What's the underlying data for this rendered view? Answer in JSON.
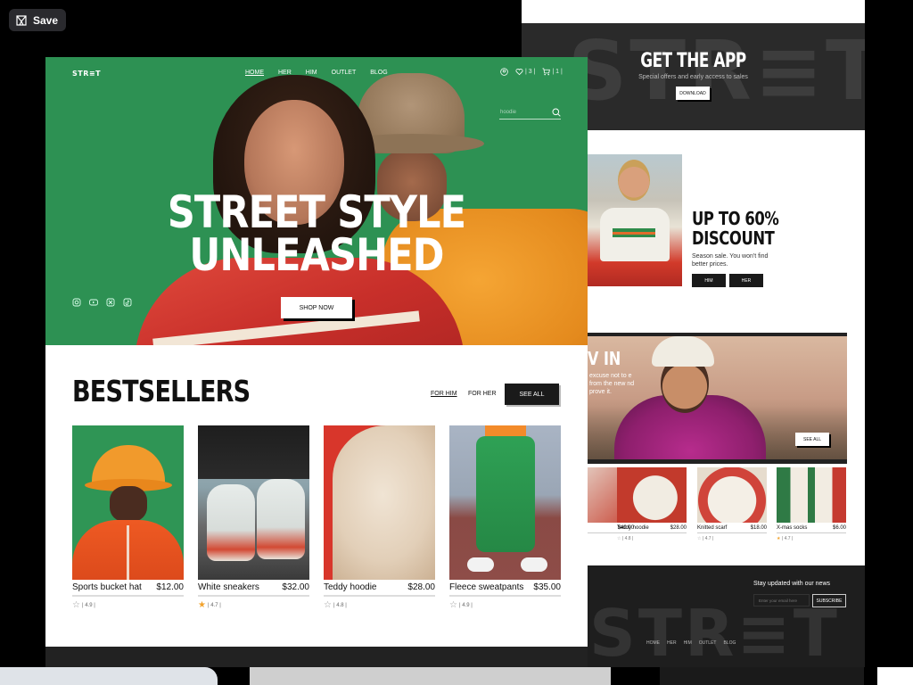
{
  "save": {
    "label": "Save"
  },
  "header": {
    "brand": "STR≡T",
    "nav": [
      {
        "label": "HOME"
      },
      {
        "label": "HER"
      },
      {
        "label": "HIM"
      },
      {
        "label": "OUTLET"
      },
      {
        "label": "BLOG"
      }
    ],
    "wishlist_count": "| 3 |",
    "cart_count": "| 1 |",
    "search_value": "hoodie"
  },
  "hero": {
    "title_line1": "STREET STYLE",
    "title_line2": "UNLEASHED",
    "button": "SHOP NOW"
  },
  "bestsellers": {
    "title": "BESTSELLERS",
    "tab_him": "FOR HIM",
    "tab_her": "FOR HER",
    "see_all": "SEE ALL",
    "products": [
      {
        "name": "Sports bucket hat",
        "price": "$12.00",
        "rating": "| 4.9 |",
        "favorite": false
      },
      {
        "name": "White sneakers",
        "price": "$32.00",
        "rating": "| 4.7 |",
        "favorite": true
      },
      {
        "name": "Teddy hoodie",
        "price": "$28.00",
        "rating": "| 4.8 |",
        "favorite": false
      },
      {
        "name": "Fleece sweatpants",
        "price": "$35.00",
        "rating": "| 4.9 |",
        "favorite": false
      }
    ]
  },
  "app_banner": {
    "ghost": "STR≡T",
    "title": "GET THE APP",
    "subtitle": "Special offers and early access to sales",
    "button": "DOWNLOAD"
  },
  "discount": {
    "title_line1": "UP TO 60%",
    "title_line2": "DISCOUNT",
    "text": "Season sale. You won't find better prices.",
    "btn_him": "HIM",
    "btn_her": "HER"
  },
  "winter": {
    "title": "V IN",
    "text": "excuse not to e from the new nd prove it.",
    "button": "SEE ALL"
  },
  "mini_products": [
    {
      "name": "",
      "price": "$40.00",
      "rating": ""
    },
    {
      "name": "Teddy hoodie",
      "price": "$28.00",
      "rating": "| 4.8 |"
    },
    {
      "name": "Knitted scarf",
      "price": "$18.00",
      "rating": "| 4.7 |"
    },
    {
      "name": "X-mas socks",
      "price": "$6.00",
      "rating": "| 4.7 |"
    }
  ],
  "newsletter": {
    "title": "Stay updated with our news",
    "placeholder": "Enter your email here",
    "button": "SUBSCRIBE",
    "ghost": "STR≡T",
    "nav": [
      "HOME",
      "HER",
      "HIM",
      "OUTLET",
      "BLOG"
    ]
  },
  "colors": {
    "hero_green": "#2d9153",
    "dark": "#1a1a1a",
    "star": "#f2a22c"
  }
}
